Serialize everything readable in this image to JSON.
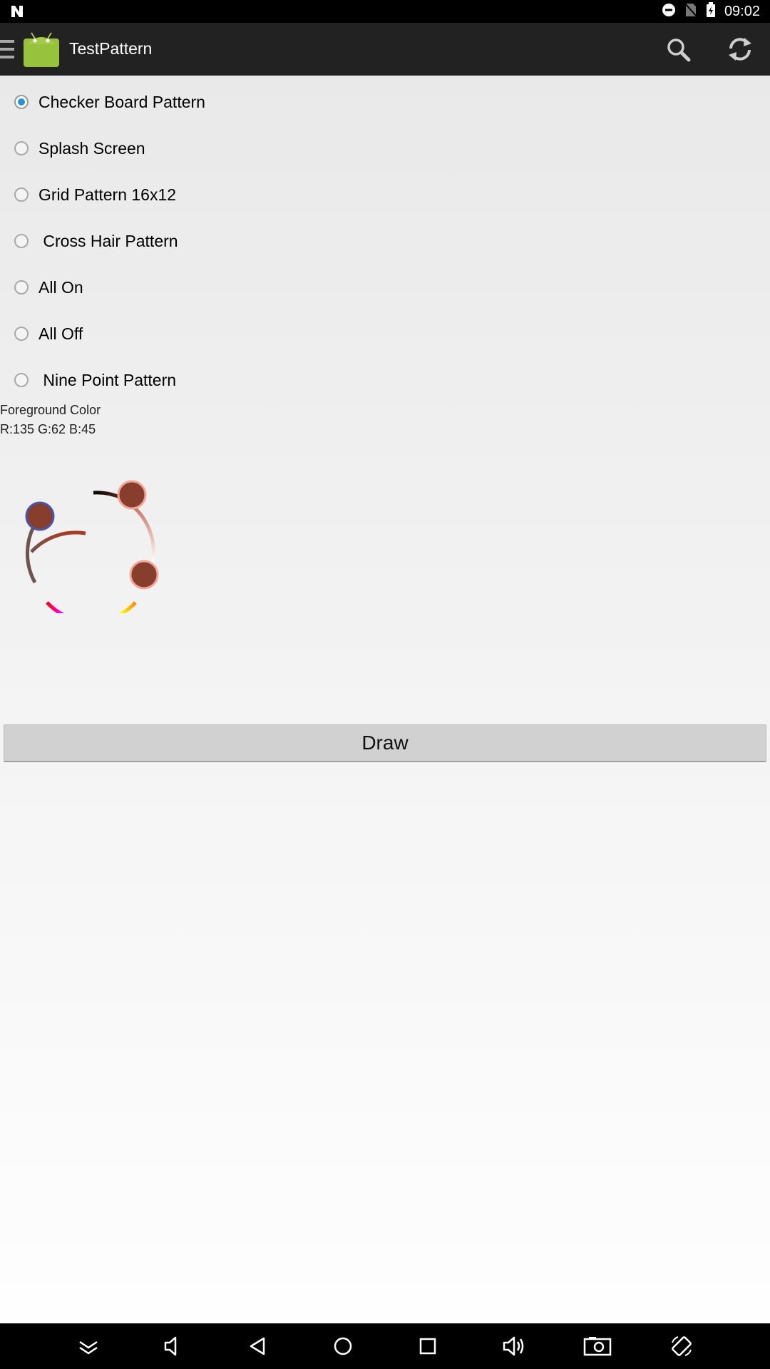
{
  "status_bar": {
    "time": "09:02",
    "icons": [
      "notification-n-icon",
      "do-not-disturb-icon",
      "no-sim-icon",
      "battery-icon"
    ]
  },
  "action_bar": {
    "title": "TestPattern",
    "icons": [
      "menu-icon",
      "android-app-icon",
      "search-icon",
      "refresh-icon"
    ]
  },
  "patterns": [
    {
      "label": "Checker Board Pattern",
      "checked": true
    },
    {
      "label": "Splash Screen",
      "checked": false
    },
    {
      "label": "Grid Pattern 16x12",
      "checked": false
    },
    {
      "label": " Cross Hair Pattern",
      "checked": false
    },
    {
      "label": "All On",
      "checked": false
    },
    {
      "label": "All Off",
      "checked": false
    },
    {
      "label": " Nine Point Pattern",
      "checked": false
    }
  ],
  "foreground": {
    "title": "Foreground Color",
    "value": "R:135 G:62 B:45",
    "color": "#873e2d"
  },
  "draw_button": {
    "label": "Draw"
  },
  "nav_bar": {
    "icons": [
      "collapse-icon",
      "volume-down-icon",
      "back-icon",
      "home-icon",
      "recents-icon",
      "volume-up-icon",
      "screenshot-icon",
      "rotate-icon"
    ]
  },
  "colors": {
    "status_bar": "#000000",
    "action_bar": "#222222",
    "radio_checked": "#2b95d2",
    "button": "#d1d1d1"
  }
}
